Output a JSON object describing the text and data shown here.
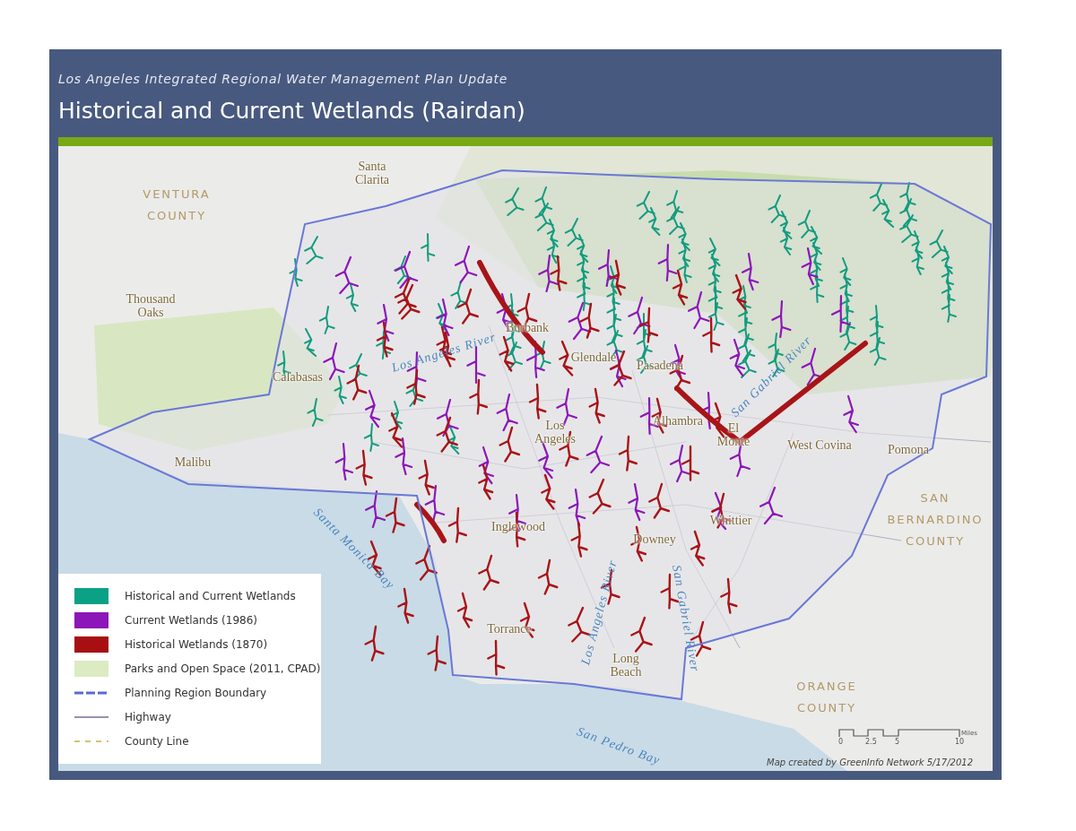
{
  "header": {
    "subtitle": "Los Angeles Integrated Regional Water Management Plan Update",
    "title": "Historical and Current Wetlands (Rairdan)"
  },
  "map": {
    "labels": [
      {
        "kind": "place",
        "text": "Santa Clarita"
      },
      {
        "kind": "county",
        "text": "VENTURA COUNTY"
      },
      {
        "kind": "place",
        "text": "Thousand Oaks"
      },
      {
        "kind": "place",
        "text": "Calabasas"
      },
      {
        "kind": "place",
        "text": "Malibu"
      },
      {
        "kind": "place",
        "text": "Burbank"
      },
      {
        "kind": "place",
        "text": "Glendale"
      },
      {
        "kind": "place",
        "text": "Pasadena"
      },
      {
        "kind": "place",
        "text": "Los Angeles"
      },
      {
        "kind": "place",
        "text": "Alhambra"
      },
      {
        "kind": "place",
        "text": "El Monte"
      },
      {
        "kind": "place",
        "text": "West Covina"
      },
      {
        "kind": "place",
        "text": "Pomona"
      },
      {
        "kind": "county",
        "text": "SAN BERNARDINO COUNTY"
      },
      {
        "kind": "place",
        "text": "Inglewood"
      },
      {
        "kind": "place",
        "text": "Downey"
      },
      {
        "kind": "place",
        "text": "Whittier"
      },
      {
        "kind": "place",
        "text": "Torrance"
      },
      {
        "kind": "place",
        "text": "Long Beach"
      },
      {
        "kind": "county",
        "text": "ORANGE COUNTY"
      },
      {
        "kind": "water",
        "text": "Los Angeles River"
      },
      {
        "kind": "water",
        "text": "San Gabriel River"
      },
      {
        "kind": "water",
        "text": "Santa Monica Bay"
      },
      {
        "kind": "water",
        "text": "Los Angeles River"
      },
      {
        "kind": "water",
        "text": "San Gabriel River"
      },
      {
        "kind": "water",
        "text": "San Pedro Bay"
      }
    ]
  },
  "legend": {
    "items": [
      {
        "kind": "swatch",
        "label": "Historical and Current Wetlands",
        "color": "#0ba184"
      },
      {
        "kind": "swatch",
        "label": "Current Wetlands (1986)",
        "color": "#8c16b8"
      },
      {
        "kind": "swatch",
        "label": "Historical Wetlands (1870)",
        "color": "#a80f12"
      },
      {
        "kind": "swatch",
        "label": "Parks and Open Space (2011, CPAD)",
        "color": "#dcebc2"
      },
      {
        "kind": "boundary",
        "label": "Planning Region Boundary",
        "color": "#5a6ad0"
      },
      {
        "kind": "highway",
        "label": "Highway",
        "color": "#9a8fb0"
      },
      {
        "kind": "county",
        "label": "County Line",
        "color": "#d8c070"
      }
    ]
  },
  "scale_bar": {
    "ticks": [
      "0",
      "2.5",
      "5",
      "10"
    ],
    "unit": "Miles"
  },
  "credit": "Map created by GreenInfo Network 5/17/2012"
}
